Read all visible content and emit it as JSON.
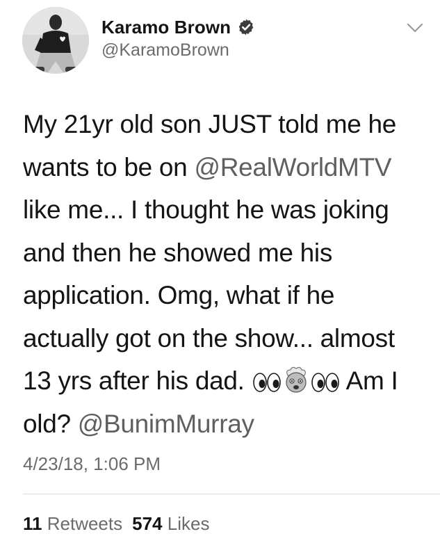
{
  "author": {
    "display_name": "Karamo Brown",
    "handle": "@KaramoBrown",
    "verified": true
  },
  "tweet": {
    "line1": "My 21yr old son JUST told me he",
    "line2_pre": "wants to be on ",
    "mention1": "@RealWorldMTV",
    "line3": "like me... I thought he was joking",
    "line4": "and then he showed me his",
    "line5": "application. Omg, what if he",
    "line6": "actually got on the show... almost",
    "line7_pre": "13 yrs after his dad. ",
    "emoji_seq": [
      "eyes",
      "exploding-head",
      "eyes"
    ],
    "line7_post": " Am I",
    "line8_pre": "old? ",
    "mention2": "@BunimMurray"
  },
  "timestamp": "4/23/18, 1:06 PM",
  "stats": {
    "retweets_count": "11",
    "retweets_label": "Retweets",
    "likes_count": "574",
    "likes_label": "Likes"
  },
  "icons": {
    "verified": "verified-badge-icon",
    "menu": "chevron-down-icon"
  },
  "colors": {
    "text": "#141414",
    "secondary": "#6b6b6b",
    "mention": "#5f5f5f",
    "divider": "#dcdcdc"
  }
}
